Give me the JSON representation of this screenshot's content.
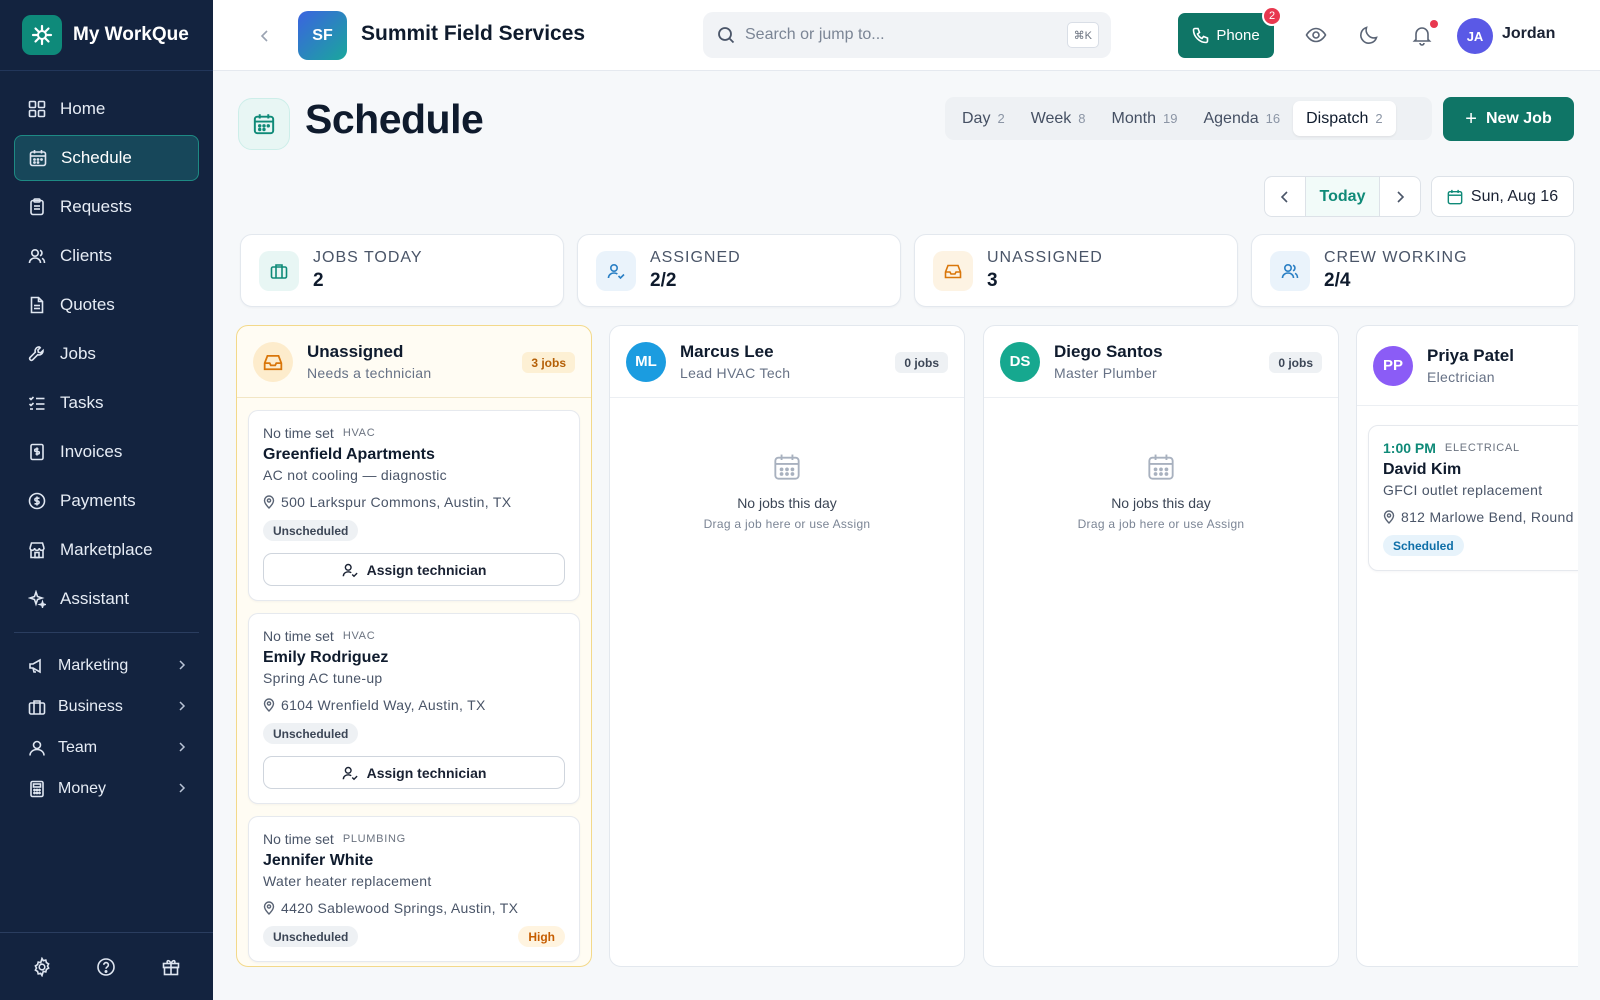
{
  "app": {
    "name": "My WorkQue"
  },
  "sidebar": {
    "items": [
      {
        "label": "Home",
        "icon": "home-icon"
      },
      {
        "label": "Schedule",
        "icon": "calendar-icon",
        "active": true
      },
      {
        "label": "Requests",
        "icon": "clipboard-icon"
      },
      {
        "label": "Clients",
        "icon": "users-icon"
      },
      {
        "label": "Quotes",
        "icon": "document-icon"
      },
      {
        "label": "Jobs",
        "icon": "wrench-icon"
      },
      {
        "label": "Tasks",
        "icon": "checklist-icon"
      },
      {
        "label": "Invoices",
        "icon": "invoice-icon"
      },
      {
        "label": "Payments",
        "icon": "dollar-icon"
      },
      {
        "label": "Marketplace",
        "icon": "store-icon"
      },
      {
        "label": "Assistant",
        "icon": "sparkle-icon"
      }
    ],
    "groups": [
      {
        "label": "Marketing",
        "icon": "megaphone-icon"
      },
      {
        "label": "Business",
        "icon": "briefcase-icon"
      },
      {
        "label": "Team",
        "icon": "team-icon"
      },
      {
        "label": "Money",
        "icon": "calculator-icon"
      }
    ]
  },
  "topbar": {
    "org_initials": "SF",
    "org_name": "Summit Field Services",
    "search_placeholder": "Search or jump to...",
    "search_shortcut": "⌘K",
    "phone_label": "Phone",
    "phone_badge": "2",
    "user_initials": "JA",
    "user_name": "Jordan"
  },
  "page": {
    "title": "Schedule",
    "view_tabs": [
      {
        "label": "Day",
        "count": "2"
      },
      {
        "label": "Week",
        "count": "8"
      },
      {
        "label": "Month",
        "count": "19"
      },
      {
        "label": "Agenda",
        "count": "16"
      },
      {
        "label": "Dispatch",
        "count": "2",
        "active": true
      }
    ],
    "new_job_label": "New Job",
    "today_label": "Today",
    "date_label": "Sun, Aug 16"
  },
  "stats": [
    {
      "label": "JOBS TODAY",
      "value": "2",
      "icon": "briefcase-icon",
      "color": "#0f8a78",
      "bg": "#e8f6f4"
    },
    {
      "label": "ASSIGNED",
      "value": "2/2",
      "icon": "user-check-icon",
      "color": "#2a7fc4",
      "bg": "#eaf3fb"
    },
    {
      "label": "UNASSIGNED",
      "value": "3",
      "icon": "inbox-icon",
      "color": "#d9760a",
      "bg": "#fdf3e3"
    },
    {
      "label": "CREW WORKING",
      "value": "2/4",
      "icon": "team-icon",
      "color": "#2a7fc4",
      "bg": "#eaf3fb"
    }
  ],
  "columns": {
    "unassigned": {
      "title": "Unassigned",
      "subtitle": "Needs a technician",
      "count": "3 jobs",
      "jobs": [
        {
          "time": "No time set",
          "trade": "HVAC",
          "client": "Greenfield Apartments",
          "desc": "AC not cooling — diagnostic",
          "address": "500 Larkspur Commons, Austin, TX",
          "status": "Unscheduled",
          "assign_label": "Assign technician"
        },
        {
          "time": "No time set",
          "trade": "HVAC",
          "client": "Emily Rodriguez",
          "desc": "Spring AC tune-up",
          "address": "6104 Wrenfield Way, Austin, TX",
          "status": "Unscheduled",
          "assign_label": "Assign technician"
        },
        {
          "time": "No time set",
          "trade": "PLUMBING",
          "client": "Jennifer White",
          "desc": "Water heater replacement",
          "address": "4420 Sablewood Springs, Austin, TX",
          "status": "Unscheduled",
          "priority": "High"
        }
      ]
    },
    "techs": [
      {
        "initials": "ML",
        "name": "Marcus Lee",
        "role": "Lead HVAC Tech",
        "count": "0 jobs",
        "color": "#1b9ce0",
        "empty_title": "No jobs this day",
        "empty_hint": "Drag a job here or use Assign"
      },
      {
        "initials": "DS",
        "name": "Diego Santos",
        "role": "Master Plumber",
        "count": "0 jobs",
        "color": "#16a88f",
        "empty_title": "No jobs this day",
        "empty_hint": "Drag a job here or use Assign"
      },
      {
        "initials": "PP",
        "name": "Priya Patel",
        "role": "Electrician",
        "color": "#8b5cf6",
        "job": {
          "time": "1:00 PM",
          "trade": "ELECTRICAL",
          "client": "David Kim",
          "desc": "GFCI outlet replacement",
          "address": "812 Marlowe Bend, Round",
          "status": "Scheduled"
        }
      }
    ]
  }
}
